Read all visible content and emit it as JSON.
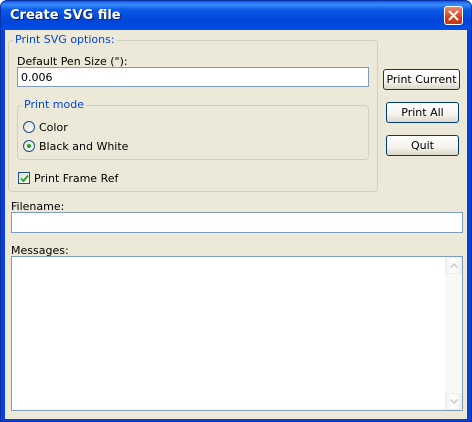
{
  "window": {
    "title": "Create SVG file"
  },
  "print_options": {
    "legend": "Print SVG options:",
    "pen_size_label": "Default Pen Size (\"):",
    "pen_size_value": "0.006",
    "print_mode": {
      "legend": "Print mode",
      "options": [
        {
          "label": "Color",
          "selected": false
        },
        {
          "label": "Black and White",
          "selected": true
        }
      ]
    },
    "frame_ref": {
      "label": "Print Frame Ref",
      "checked": true
    }
  },
  "buttons": {
    "print_current": "Print Current",
    "print_all": "Print All",
    "quit": "Quit"
  },
  "filename": {
    "label": "Filename:",
    "value": ""
  },
  "messages": {
    "label": "Messages:",
    "value": ""
  },
  "icons": {
    "close": "close-icon",
    "checkmark": "checkmark-icon",
    "scroll_up": "up-arrow-icon",
    "scroll_down": "down-arrow-icon"
  },
  "colors": {
    "title_bar": "#0054e3",
    "dialog_bg": "#ece9d8",
    "group_label": "#0046d5",
    "close_button": "#d0441c",
    "radio_dot": "#21a121"
  }
}
